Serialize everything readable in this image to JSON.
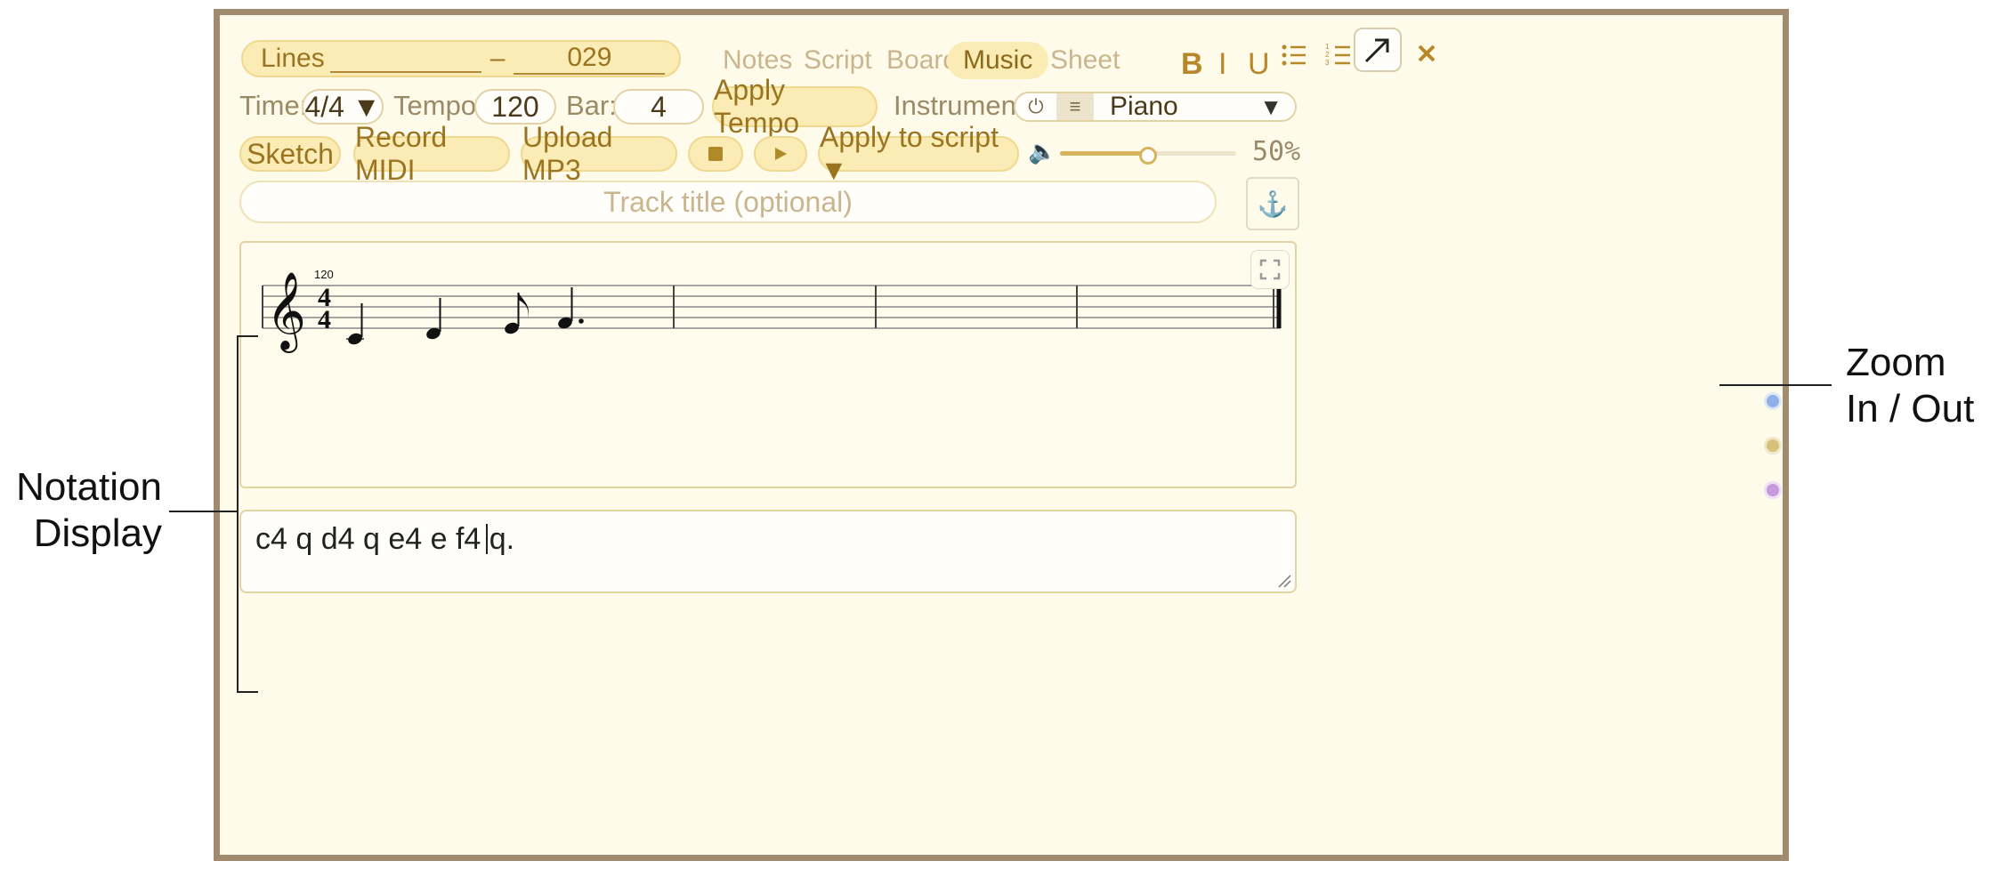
{
  "toolbar": {
    "lines_label": "Lines",
    "lines_sep": "–",
    "lines_value": "029",
    "tabs": [
      "Notes",
      "Script",
      "Board",
      "Music",
      "Sheet"
    ],
    "active_tab": "Music",
    "format": {
      "bold": "B",
      "italic": "I",
      "underline": "U"
    }
  },
  "settings": {
    "time_label": "Time:",
    "time_value": "4/4 ▼",
    "tempo_label": "Tempo:",
    "tempo_value": "120",
    "bar_label": "Bar:",
    "bar_value": "4",
    "apply_tempo": "Apply Tempo",
    "instrument_label": "Instrument:",
    "instrument_value": "Piano",
    "instrument_caret": "▼"
  },
  "actions": {
    "sketch": "Sketch",
    "record_midi": "Record MIDI",
    "upload_mp3": "Upload MP3",
    "apply_to_script": "Apply to script ▼",
    "volume_level": 0.5,
    "volume_text": "50%"
  },
  "track": {
    "placeholder": "Track title (optional)"
  },
  "score": {
    "tempo_mark": "120",
    "time_sig_top": "4",
    "time_sig_bottom": "4",
    "notes": [
      "C4",
      "D4",
      "E4",
      "F4"
    ]
  },
  "editor": {
    "text": "c4 q d4 q e4 e f4 q."
  },
  "dots": [
    "#8fb0e8",
    "#d8c27a",
    "#c79ae0"
  ],
  "annotations": {
    "zoom_line1": "Zoom",
    "zoom_line2": "In / Out",
    "notation_line1": "Notation",
    "notation_line2": "Display"
  }
}
